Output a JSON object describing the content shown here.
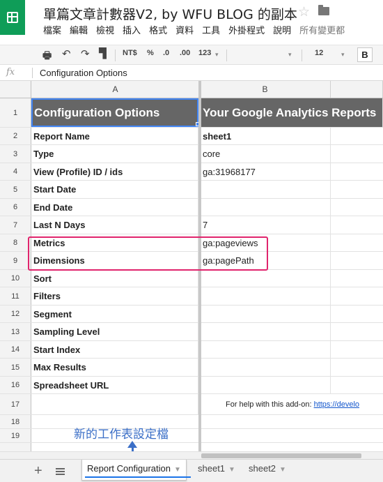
{
  "header": {
    "doc_title": "單篇文章計數器V2, by WFU BLOG 的副本",
    "menu": [
      "檔案",
      "編輯",
      "檢視",
      "插入",
      "格式",
      "資料",
      "工具",
      "外掛程式",
      "說明"
    ],
    "last_edit": "所有變更都"
  },
  "toolbar": {
    "currency": "NT$",
    "percent": "%",
    "decimal_decrease": ".0",
    "decimal_increase": ".00",
    "more_formats": "123",
    "font_size": "12",
    "bold": "B"
  },
  "formula_bar": {
    "fx": "fx",
    "content": "Configuration Options"
  },
  "columns": [
    "A",
    "B"
  ],
  "rows": [
    {
      "n": "1",
      "a": "Configuration Options",
      "b": "Your Google Analytics Reports"
    },
    {
      "n": "2",
      "a": "Report Name",
      "b": "sheet1"
    },
    {
      "n": "3",
      "a": "Type",
      "b": "core"
    },
    {
      "n": "4",
      "a": "View (Profile) ID / ids",
      "b": "ga:31968177"
    },
    {
      "n": "5",
      "a": "Start Date",
      "b": ""
    },
    {
      "n": "6",
      "a": "End Date",
      "b": ""
    },
    {
      "n": "7",
      "a": "Last N Days",
      "b": "7"
    },
    {
      "n": "8",
      "a": "Metrics",
      "b": "ga:pageviews"
    },
    {
      "n": "9",
      "a": "Dimensions",
      "b": "ga:pagePath"
    },
    {
      "n": "10",
      "a": "Sort",
      "b": ""
    },
    {
      "n": "11",
      "a": "Filters",
      "b": ""
    },
    {
      "n": "12",
      "a": "Segment",
      "b": ""
    },
    {
      "n": "13",
      "a": "Sampling Level",
      "b": ""
    },
    {
      "n": "14",
      "a": "Start Index",
      "b": ""
    },
    {
      "n": "15",
      "a": "Max Results",
      "b": ""
    },
    {
      "n": "16",
      "a": "Spreadsheet URL",
      "b": ""
    },
    {
      "n": "17",
      "a": "",
      "b": ""
    },
    {
      "n": "18",
      "a": "",
      "b": ""
    },
    {
      "n": "19",
      "a": "",
      "b": ""
    }
  ],
  "help": {
    "text": "For help with this add-on:",
    "link": "https://develo"
  },
  "annotation": "新的工作表設定檔",
  "sheets": [
    {
      "label": "Report Configuration",
      "active": true
    },
    {
      "label": "sheet1",
      "active": false
    },
    {
      "label": "sheet2",
      "active": false
    }
  ],
  "colors": {
    "brand_green": "#0f9d58",
    "header_fill": "#666666",
    "selection_blue": "#4285f4",
    "highlight_pink": "#e0246c",
    "annotation_blue": "#3b6fc7"
  }
}
